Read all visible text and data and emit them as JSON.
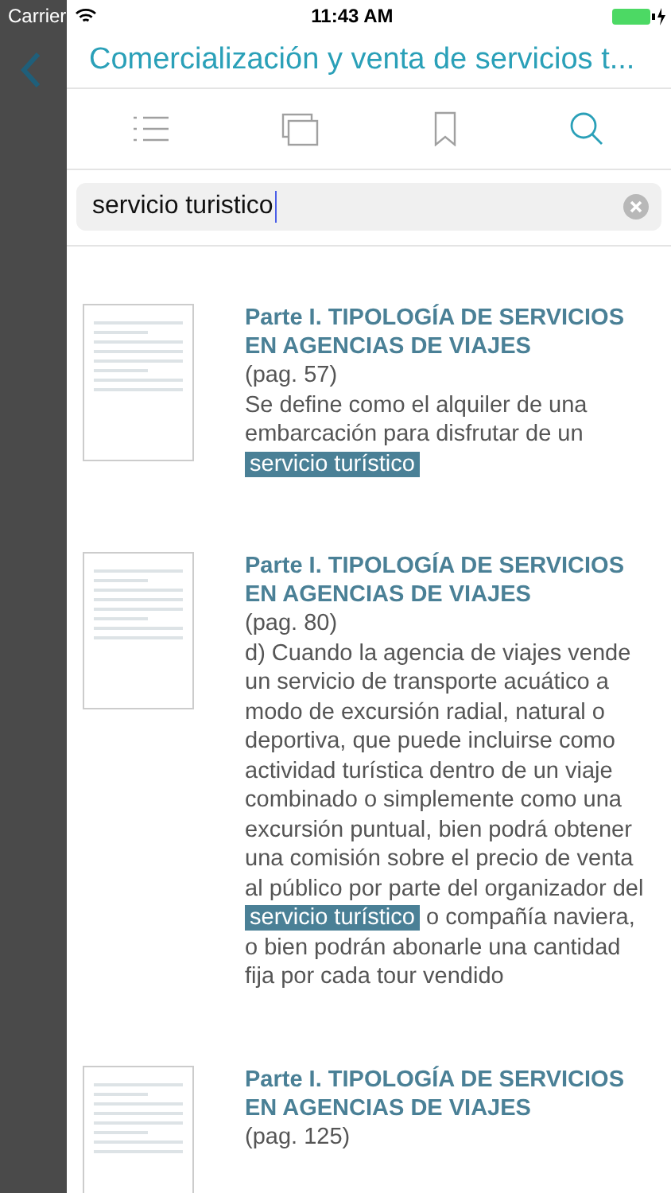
{
  "status_bar": {
    "carrier": "Carrier",
    "time": "11:43 AM"
  },
  "nav": {
    "title": "Comercialización y venta de servicios t..."
  },
  "toolbar_tabs": [
    {
      "kind": "list",
      "selected": false
    },
    {
      "kind": "pages",
      "selected": false
    },
    {
      "kind": "bookmark",
      "selected": false
    },
    {
      "kind": "search",
      "selected": true
    }
  ],
  "search": {
    "value": "servicio turistico"
  },
  "results": [
    {
      "title": "Parte I. TIPOLOGÍA DE SERVICIOS EN AGENCIAS DE VIAJES",
      "page": "(pag. 57)",
      "excerpt": [
        {
          "text": " Se define como el alquiler de una embarcación para disfrutar de un ",
          "highlighted": false
        },
        {
          "text": "servicio turístico",
          "highlighted": true
        }
      ]
    },
    {
      "title": "Parte I. TIPOLOGÍA DE SERVICIOS EN AGENCIAS DE VIAJES",
      "page": "(pag. 80)",
      "excerpt": [
        {
          "text": "d) Cuando la agencia de viajes vende un servicio de transporte acuático a modo de excursión radial, natural o deportiva, que puede incluirse como actividad turística dentro de un viaje combinado o simplemente como una excursión puntual, bien podrá obtener una comisión sobre el precio de venta al público por parte del organizador del ",
          "highlighted": false
        },
        {
          "text": "servicio turístico",
          "highlighted": true
        },
        {
          "text": " o compañía naviera, o bien podrán abonarle una cantidad fija por cada tour vendido",
          "highlighted": false
        }
      ]
    },
    {
      "title": "Parte I. TIPOLOGÍA DE SERVICIOS EN AGENCIAS DE VIAJES",
      "page": "(pag. 125)"
    }
  ]
}
